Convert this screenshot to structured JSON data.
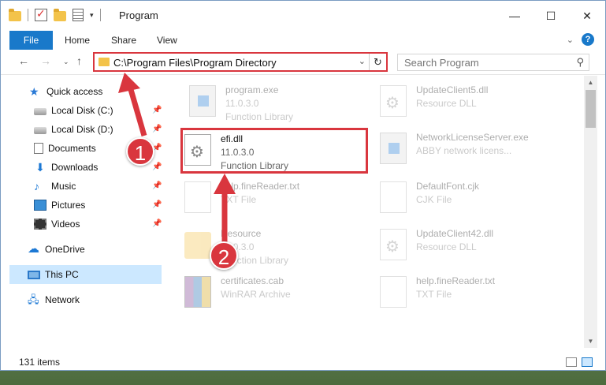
{
  "window": {
    "title": "Program",
    "controls": {
      "minimize": "—",
      "maximize": "☐",
      "close": "✕"
    }
  },
  "ribbon": {
    "tabs": [
      {
        "label": "File"
      },
      {
        "label": "Home"
      },
      {
        "label": "Share"
      },
      {
        "label": "View"
      }
    ],
    "collapse_icon": "chevron-down-icon",
    "help_label": "?"
  },
  "navigation": {
    "address_path": "C:\\Program Files\\Program Directory",
    "search_placeholder": "Search Program"
  },
  "sidebar": {
    "items": [
      {
        "label": "Quick access",
        "icon": "star-icon"
      },
      {
        "label": "Local Disk (C:)",
        "icon": "disk-icon",
        "pinned": true
      },
      {
        "label": "Local Disk (D:)",
        "icon": "disk-icon",
        "pinned": true
      },
      {
        "label": "Documents",
        "icon": "documents-icon",
        "pinned": true
      },
      {
        "label": "Downloads",
        "icon": "download-icon",
        "pinned": true
      },
      {
        "label": "Music",
        "icon": "music-icon",
        "pinned": true
      },
      {
        "label": "Pictures",
        "icon": "pictures-icon",
        "pinned": true
      },
      {
        "label": "Videos",
        "icon": "videos-icon",
        "pinned": true
      },
      {
        "label": "OneDrive",
        "icon": "cloud-icon"
      },
      {
        "label": "This PC",
        "icon": "computer-icon",
        "selected": true
      },
      {
        "label": "Network",
        "icon": "network-icon"
      }
    ]
  },
  "files": [
    {
      "name": "program.exe",
      "meta1": "11.0.3.0",
      "meta2": "Function Library",
      "icon": "exe-icon"
    },
    {
      "name": "UpdateClient5.dll",
      "meta1": "Resource DLL",
      "meta2": "",
      "icon": "dll-icon"
    },
    {
      "name": "efi.dll",
      "meta1": "11.0.3.0",
      "meta2": "Function Library",
      "icon": "dll-gear-icon",
      "highlighted": true
    },
    {
      "name": "NetworkLicenseServer.exe",
      "meta1": "ABBY network licens...",
      "meta2": "",
      "icon": "exe-icon"
    },
    {
      "name": "help.fineReader.txt",
      "meta1": "TXT File",
      "meta2": "",
      "icon": "text-file-icon"
    },
    {
      "name": "DefaultFont.cjk",
      "meta1": "CJK File",
      "meta2": "",
      "icon": "file-icon"
    },
    {
      "name": "Resource",
      "meta1": "11.0.3.0",
      "meta2": "Function Library",
      "icon": "folder-icon"
    },
    {
      "name": "UpdateClient42.dll",
      "meta1": "Resource DLL",
      "meta2": "",
      "icon": "dll-icon"
    },
    {
      "name": "certificates.cab",
      "meta1": "WinRAR Archive",
      "meta2": "",
      "icon": "archive-icon"
    },
    {
      "name": "help.fineReader.txt",
      "meta1": "TXT File",
      "meta2": "",
      "icon": "text-file-icon"
    }
  ],
  "status": {
    "item_count": "131 items"
  },
  "annotations": {
    "step1": "1",
    "step2": "2"
  },
  "colors": {
    "accent": "#1979ca",
    "highlight_red": "#d9363e",
    "selection": "#cce8ff"
  }
}
